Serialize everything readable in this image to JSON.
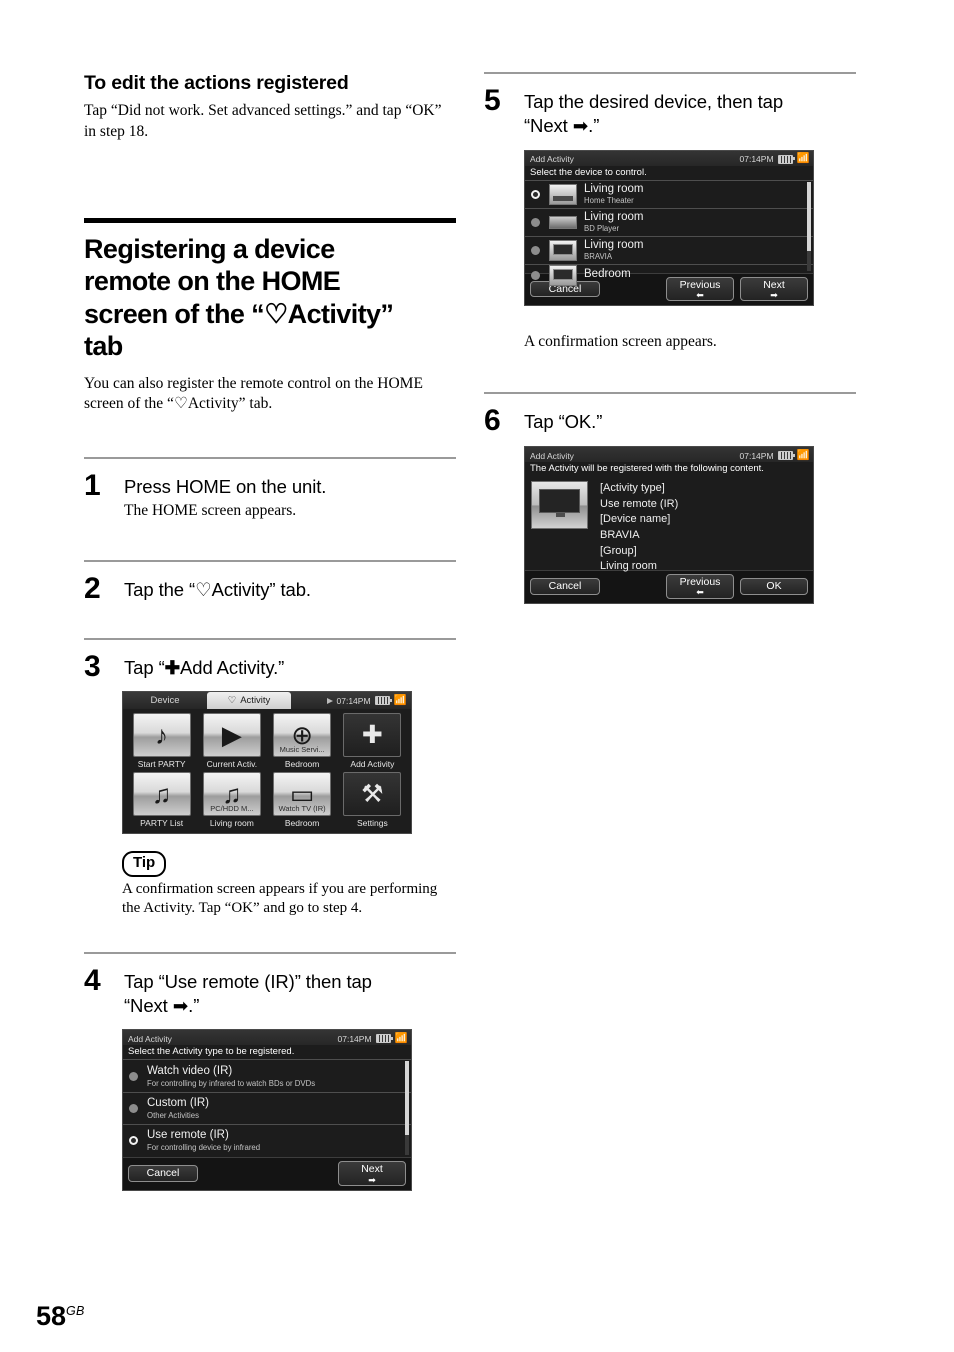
{
  "page": {
    "number": "58",
    "region": "GB"
  },
  "left_column": {
    "subsection": {
      "heading": "To edit the actions registered",
      "body": "Tap “Did not work. Set advanced settings.” and tap “OK” in step 18."
    },
    "chapter": {
      "title_line1": "Registering a device",
      "title_line2": "remote on the HOME",
      "title_line3_a": "screen of the “",
      "title_heart": "♡",
      "title_line3_b": "Activity”",
      "title_line4": "tab",
      "intro_a": "You can also register the remote control on the HOME screen of the “",
      "intro_heart": "♡",
      "intro_b": "Activity” tab."
    },
    "steps": [
      {
        "number": "1",
        "title": "Press HOME on the unit.",
        "sub": "The HOME screen appears."
      },
      {
        "number": "2",
        "title_a": "Tap the “",
        "heart": "♡",
        "title_b": "Activity” tab."
      },
      {
        "number": "3",
        "title_a": "Tap “",
        "plus": "✚",
        "title_b": "Add Activity.”"
      },
      {
        "number": "4",
        "title_line1": "Tap “Use remote (IR)” then tap",
        "title_line2_a": "“Next ",
        "arrow": "➡",
        "title_line2_b": ".”"
      }
    ],
    "tip": {
      "badge": "Tip",
      "text": "A confirmation screen appears if you are performing the Activity. Tap “OK” and go to step 4."
    },
    "home_screen": {
      "tabs": [
        {
          "label": "Device",
          "icon": "",
          "active": false
        },
        {
          "label": "Activity",
          "icon": "♡",
          "active": true
        }
      ],
      "status": {
        "time": "07:14PM",
        "play_icon": "play-icon",
        "battery_icon": "battery-icon",
        "signal_icon": "signal-icon"
      },
      "tiles": [
        {
          "label": "Start PARTY",
          "glyph": "♪",
          "overlabel": "",
          "dark": false
        },
        {
          "label": "Current Activ.",
          "glyph": "▶",
          "overlabel": "",
          "dark": false
        },
        {
          "label": "Bedroom",
          "glyph": "⊕",
          "overlabel": "Music Servi...",
          "dark": false
        },
        {
          "label": "Add Activity",
          "glyph": "✚",
          "overlabel": "",
          "dark": true
        },
        {
          "label": "PARTY List",
          "glyph": "♫",
          "overlabel": "",
          "dark": false
        },
        {
          "label": "Living room",
          "glyph": "♫",
          "overlabel": "PC/HDD M...",
          "dark": false
        },
        {
          "label": "Bedroom",
          "glyph": "▭",
          "overlabel": "Watch TV (IR)",
          "dark": false
        },
        {
          "label": "Settings",
          "glyph": "⚒",
          "overlabel": "",
          "dark": true
        }
      ]
    },
    "activity_type_screen": {
      "title": "Add Activity",
      "time": "07:14PM",
      "prompt": "Select the Activity type to be registered.",
      "options": [
        {
          "main": "Watch video (IR)",
          "sub": "For controlling by infrared to watch BDs or DVDs",
          "selected": false
        },
        {
          "main": "Custom (IR)",
          "sub": "Other Activities",
          "selected": false
        },
        {
          "main": "Use remote (IR)",
          "sub": "For controlling device by infrared",
          "selected": true
        }
      ],
      "buttons": {
        "cancel": "Cancel",
        "next": "Next",
        "next_arrow": "➡"
      }
    }
  },
  "right_column": {
    "steps": [
      {
        "number": "5",
        "title_line1": "Tap the desired device, then tap",
        "title_line2_a": "“Next ",
        "arrow": "➡",
        "title_line2_b": ".”"
      },
      {
        "number": "6",
        "title": "Tap “OK.”"
      }
    ],
    "caption_after_step5": "A confirmation screen appears.",
    "device_select_screen": {
      "title": "Add Activity",
      "time": "07:14PM",
      "prompt": "Select the device to control.",
      "rows": [
        {
          "main": "Living room",
          "sub": "Home Theater",
          "selected": true,
          "thumb": "amp"
        },
        {
          "main": "Living room",
          "sub": "BD Player",
          "selected": false,
          "thumb": "bd"
        },
        {
          "main": "Living room",
          "sub": "BRAVIA",
          "selected": false,
          "thumb": "tv"
        },
        {
          "main": "Bedroom",
          "sub": "",
          "selected": false,
          "thumb": "tv"
        }
      ],
      "buttons": {
        "cancel": "Cancel",
        "previous": "Previous",
        "previous_arrow": "⬅",
        "next": "Next",
        "next_arrow": "➡"
      }
    },
    "confirmation_screen": {
      "title": "Add Activity",
      "time": "07:14PM",
      "prompt": "The Activity will be registered with the following content.",
      "lines": [
        "[Activity type]",
        "Use remote (IR)",
        "[Device name]",
        "BRAVIA",
        "[Group]",
        "Living room"
      ],
      "buttons": {
        "cancel": "Cancel",
        "previous": "Previous",
        "previous_arrow": "⬅",
        "ok": "OK"
      }
    }
  }
}
